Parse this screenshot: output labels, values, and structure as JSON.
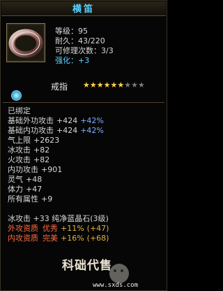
{
  "tooltip": {
    "title": "横笛",
    "level": "等级：95",
    "durability": "耐久：43/220",
    "repairs": "可修理次数：3/3",
    "strengthen_label": "强化：",
    "strengthen_value": "+3",
    "item_type": "戒指",
    "stars": {
      "filled": 6,
      "total": 9
    },
    "bound": "已绑定",
    "attributes": [
      {
        "name": "基础外功攻击",
        "value": "+424",
        "extra": "+42%"
      },
      {
        "name": "基础内功攻击",
        "value": "+424",
        "extra": "+42%"
      },
      {
        "name": "气上限",
        "value": "+2623",
        "extra": ""
      },
      {
        "name": "冰攻击",
        "value": "+82",
        "extra": ""
      },
      {
        "name": "火攻击",
        "value": "+82",
        "extra": ""
      },
      {
        "name": "内功攻击",
        "value": "+901",
        "extra": ""
      },
      {
        "name": "灵气",
        "value": "+48",
        "extra": ""
      },
      {
        "name": "体力",
        "value": "+47",
        "extra": ""
      },
      {
        "name": "所有属性",
        "value": "+9",
        "extra": ""
      }
    ],
    "gem_line": "冰攻击 +33 纯净蓝晶石(3级)",
    "qualities": [
      {
        "label": "外攻资质",
        "grade": "优秀",
        "percent": "+11%",
        "paren": "(+47)"
      },
      {
        "label": "内攻资质",
        "grade": "完美",
        "percent": "+16%",
        "paren": "(+68)"
      }
    ]
  },
  "watermark": {
    "text": "科础代售",
    "url": "www.sxds.com"
  }
}
